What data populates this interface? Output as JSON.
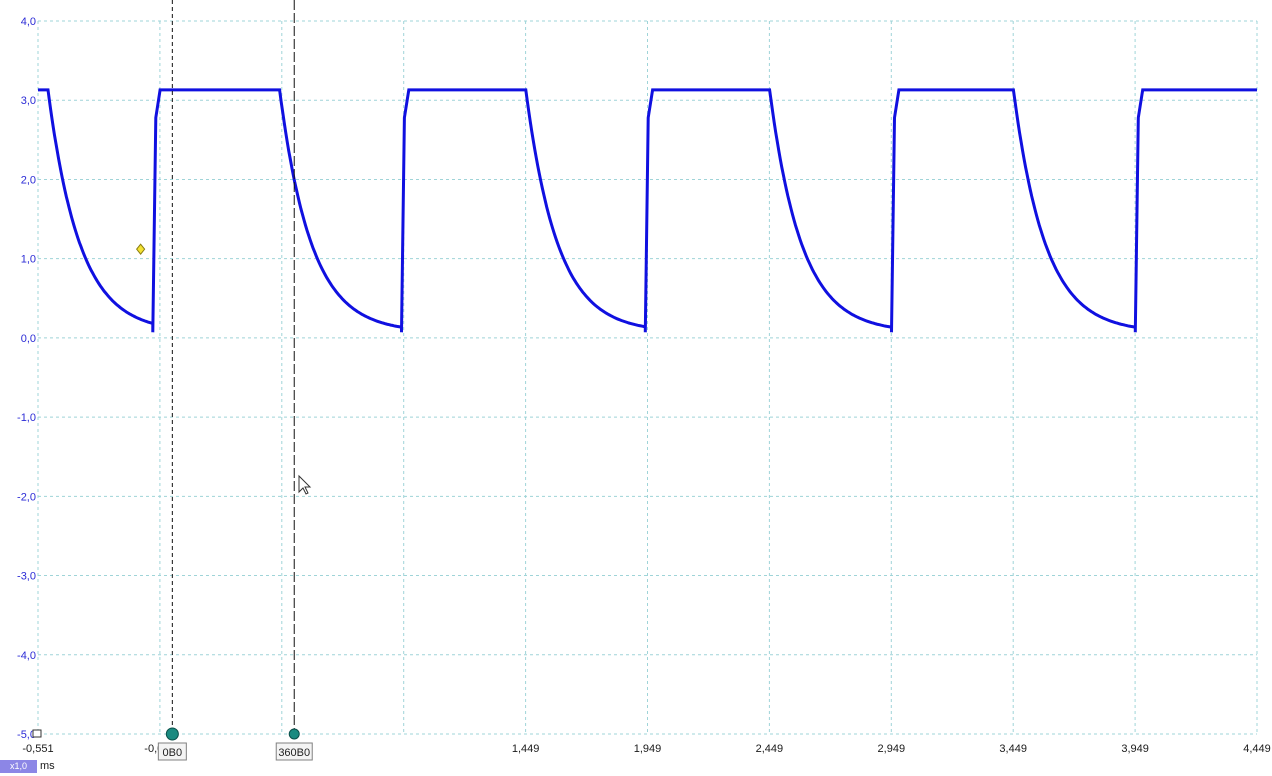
{
  "chart_data": {
    "type": "line",
    "title": "",
    "xlabel": "",
    "ylabel": "",
    "x_unit": "ms",
    "xlim": [
      -0.551,
      4.449
    ],
    "ylim": [
      -5.0,
      4.0
    ],
    "x_ticks": [
      -0.551,
      -0.051,
      0.449,
      0.949,
      1.449,
      1.949,
      2.449,
      2.949,
      3.449,
      3.949,
      4.449
    ],
    "x_tick_labels": [
      "-0,551",
      "-0,051",
      "",
      "",
      "1,449",
      "1,949",
      "2,449",
      "2,949",
      "3,449",
      "3,949",
      "4,449"
    ],
    "y_ticks": [
      4.0,
      3.0,
      2.0,
      1.0,
      0.0,
      -1.0,
      -2.0,
      -3.0,
      -4.0,
      -5.0
    ],
    "y_tick_labels": [
      "4,0",
      "3,0",
      "2,0",
      "1,0",
      "0,0",
      "-1,0",
      "-2,0",
      "-3,0",
      "-4,0",
      "-5,0"
    ],
    "grid": true,
    "series": [
      {
        "color": "#1010e0",
        "high_level": 3.13,
        "low_level": 0.07,
        "pulses": [
          {
            "rise": -0.08,
            "fall": 0.44
          },
          {
            "rise": 0.94,
            "fall": 1.45
          },
          {
            "rise": 1.94,
            "fall": 2.45
          },
          {
            "rise": 2.95,
            "fall": 3.45
          },
          {
            "rise": 3.95,
            "fall": 4.449
          }
        ],
        "start_fall": -0.51,
        "decay_tau_ms": 0.13
      }
    ],
    "trigger": {
      "x": -0.13,
      "y": 1.12,
      "color": "#f3e234"
    },
    "cursors": [
      {
        "label": "0В0",
        "x": 0.0
      },
      {
        "label": "360В0",
        "x": 0.5
      }
    ]
  },
  "scale_badge": "x1,0",
  "unit_label": "ms"
}
